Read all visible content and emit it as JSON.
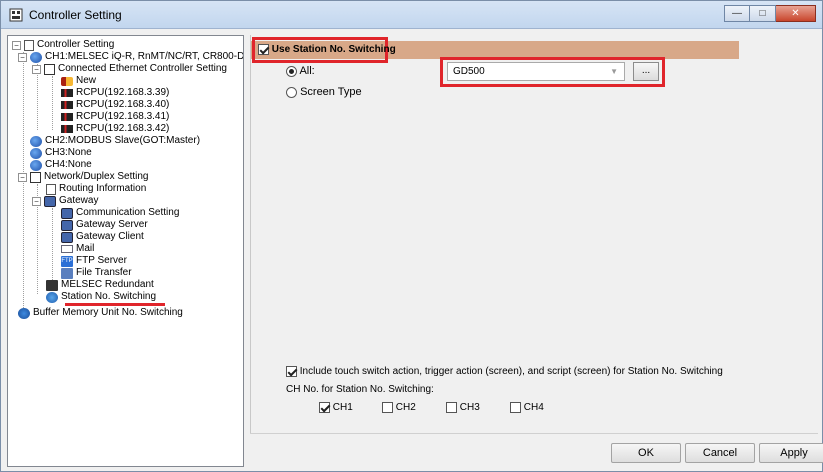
{
  "window": {
    "title": "Controller Setting",
    "buttons": {
      "minimize": "—",
      "maximize": "□",
      "close": "✕"
    }
  },
  "tree": {
    "items": [
      {
        "label": "Controller Setting",
        "icon": "settings-doc-icon"
      },
      {
        "label": "CH1:MELSEC iQ-R, RnMT/NC/RT, CR800-D",
        "icon": "channel-globe-icon"
      },
      {
        "label": "Connected Ethernet Controller Setting",
        "icon": "network-icon"
      },
      {
        "label": "New",
        "icon": "new-controller-icon"
      },
      {
        "label": "RCPU(192.168.3.39)",
        "icon": "plc-icon"
      },
      {
        "label": "RCPU(192.168.3.40)",
        "icon": "plc-icon"
      },
      {
        "label": "RCPU(192.168.3.41)",
        "icon": "plc-icon"
      },
      {
        "label": "RCPU(192.168.3.42)",
        "icon": "plc-icon"
      },
      {
        "label": "CH2:MODBUS Slave(GOT:Master)",
        "icon": "channel-globe-icon"
      },
      {
        "label": "CH3:None",
        "icon": "channel-globe-icon"
      },
      {
        "label": "CH4:None",
        "icon": "channel-globe-icon"
      },
      {
        "label": "Network/Duplex Setting",
        "icon": "network-icon"
      },
      {
        "label": "Routing Information",
        "icon": "routing-icon"
      },
      {
        "label": "Gateway",
        "icon": "gateway-icon"
      },
      {
        "label": "Communication Setting",
        "icon": "communication-icon"
      },
      {
        "label": "Gateway Server",
        "icon": "gateway-server-icon"
      },
      {
        "label": "Gateway Client",
        "icon": "gateway-client-icon"
      },
      {
        "label": "Mail",
        "icon": "mail-icon"
      },
      {
        "label": "FTP Server",
        "icon": "ftp-icon"
      },
      {
        "label": "File Transfer",
        "icon": "file-transfer-icon"
      },
      {
        "label": "MELSEC Redundant",
        "icon": "redundant-icon"
      },
      {
        "label": "Station No. Switching",
        "icon": "station-switch-icon"
      },
      {
        "label": "Buffer Memory Unit No. Switching",
        "icon": "buffer-memory-icon"
      }
    ],
    "ftp_icon_text": "FTP"
  },
  "main": {
    "use_station_label": "Use Station No. Switching",
    "use_station_checked": true,
    "radio_all_label": "All:",
    "radio_all_selected": true,
    "radio_screen_label": "Screen Type",
    "combo_value": "GD500",
    "browse_label": "...",
    "include_label": "Include touch switch action, trigger action (screen), and script (screen) for Station No. Switching",
    "include_checked": true,
    "ch_heading": "CH No. for Station No. Switching:",
    "channels": [
      {
        "label": "CH1",
        "checked": true
      },
      {
        "label": "CH2",
        "checked": false
      },
      {
        "label": "CH3",
        "checked": false
      },
      {
        "label": "CH4",
        "checked": false
      }
    ]
  },
  "footer": {
    "ok": "OK",
    "cancel": "Cancel",
    "apply": "Apply"
  },
  "colors": {
    "highlight": "#e0252b",
    "header_bar": "#d8a888"
  }
}
